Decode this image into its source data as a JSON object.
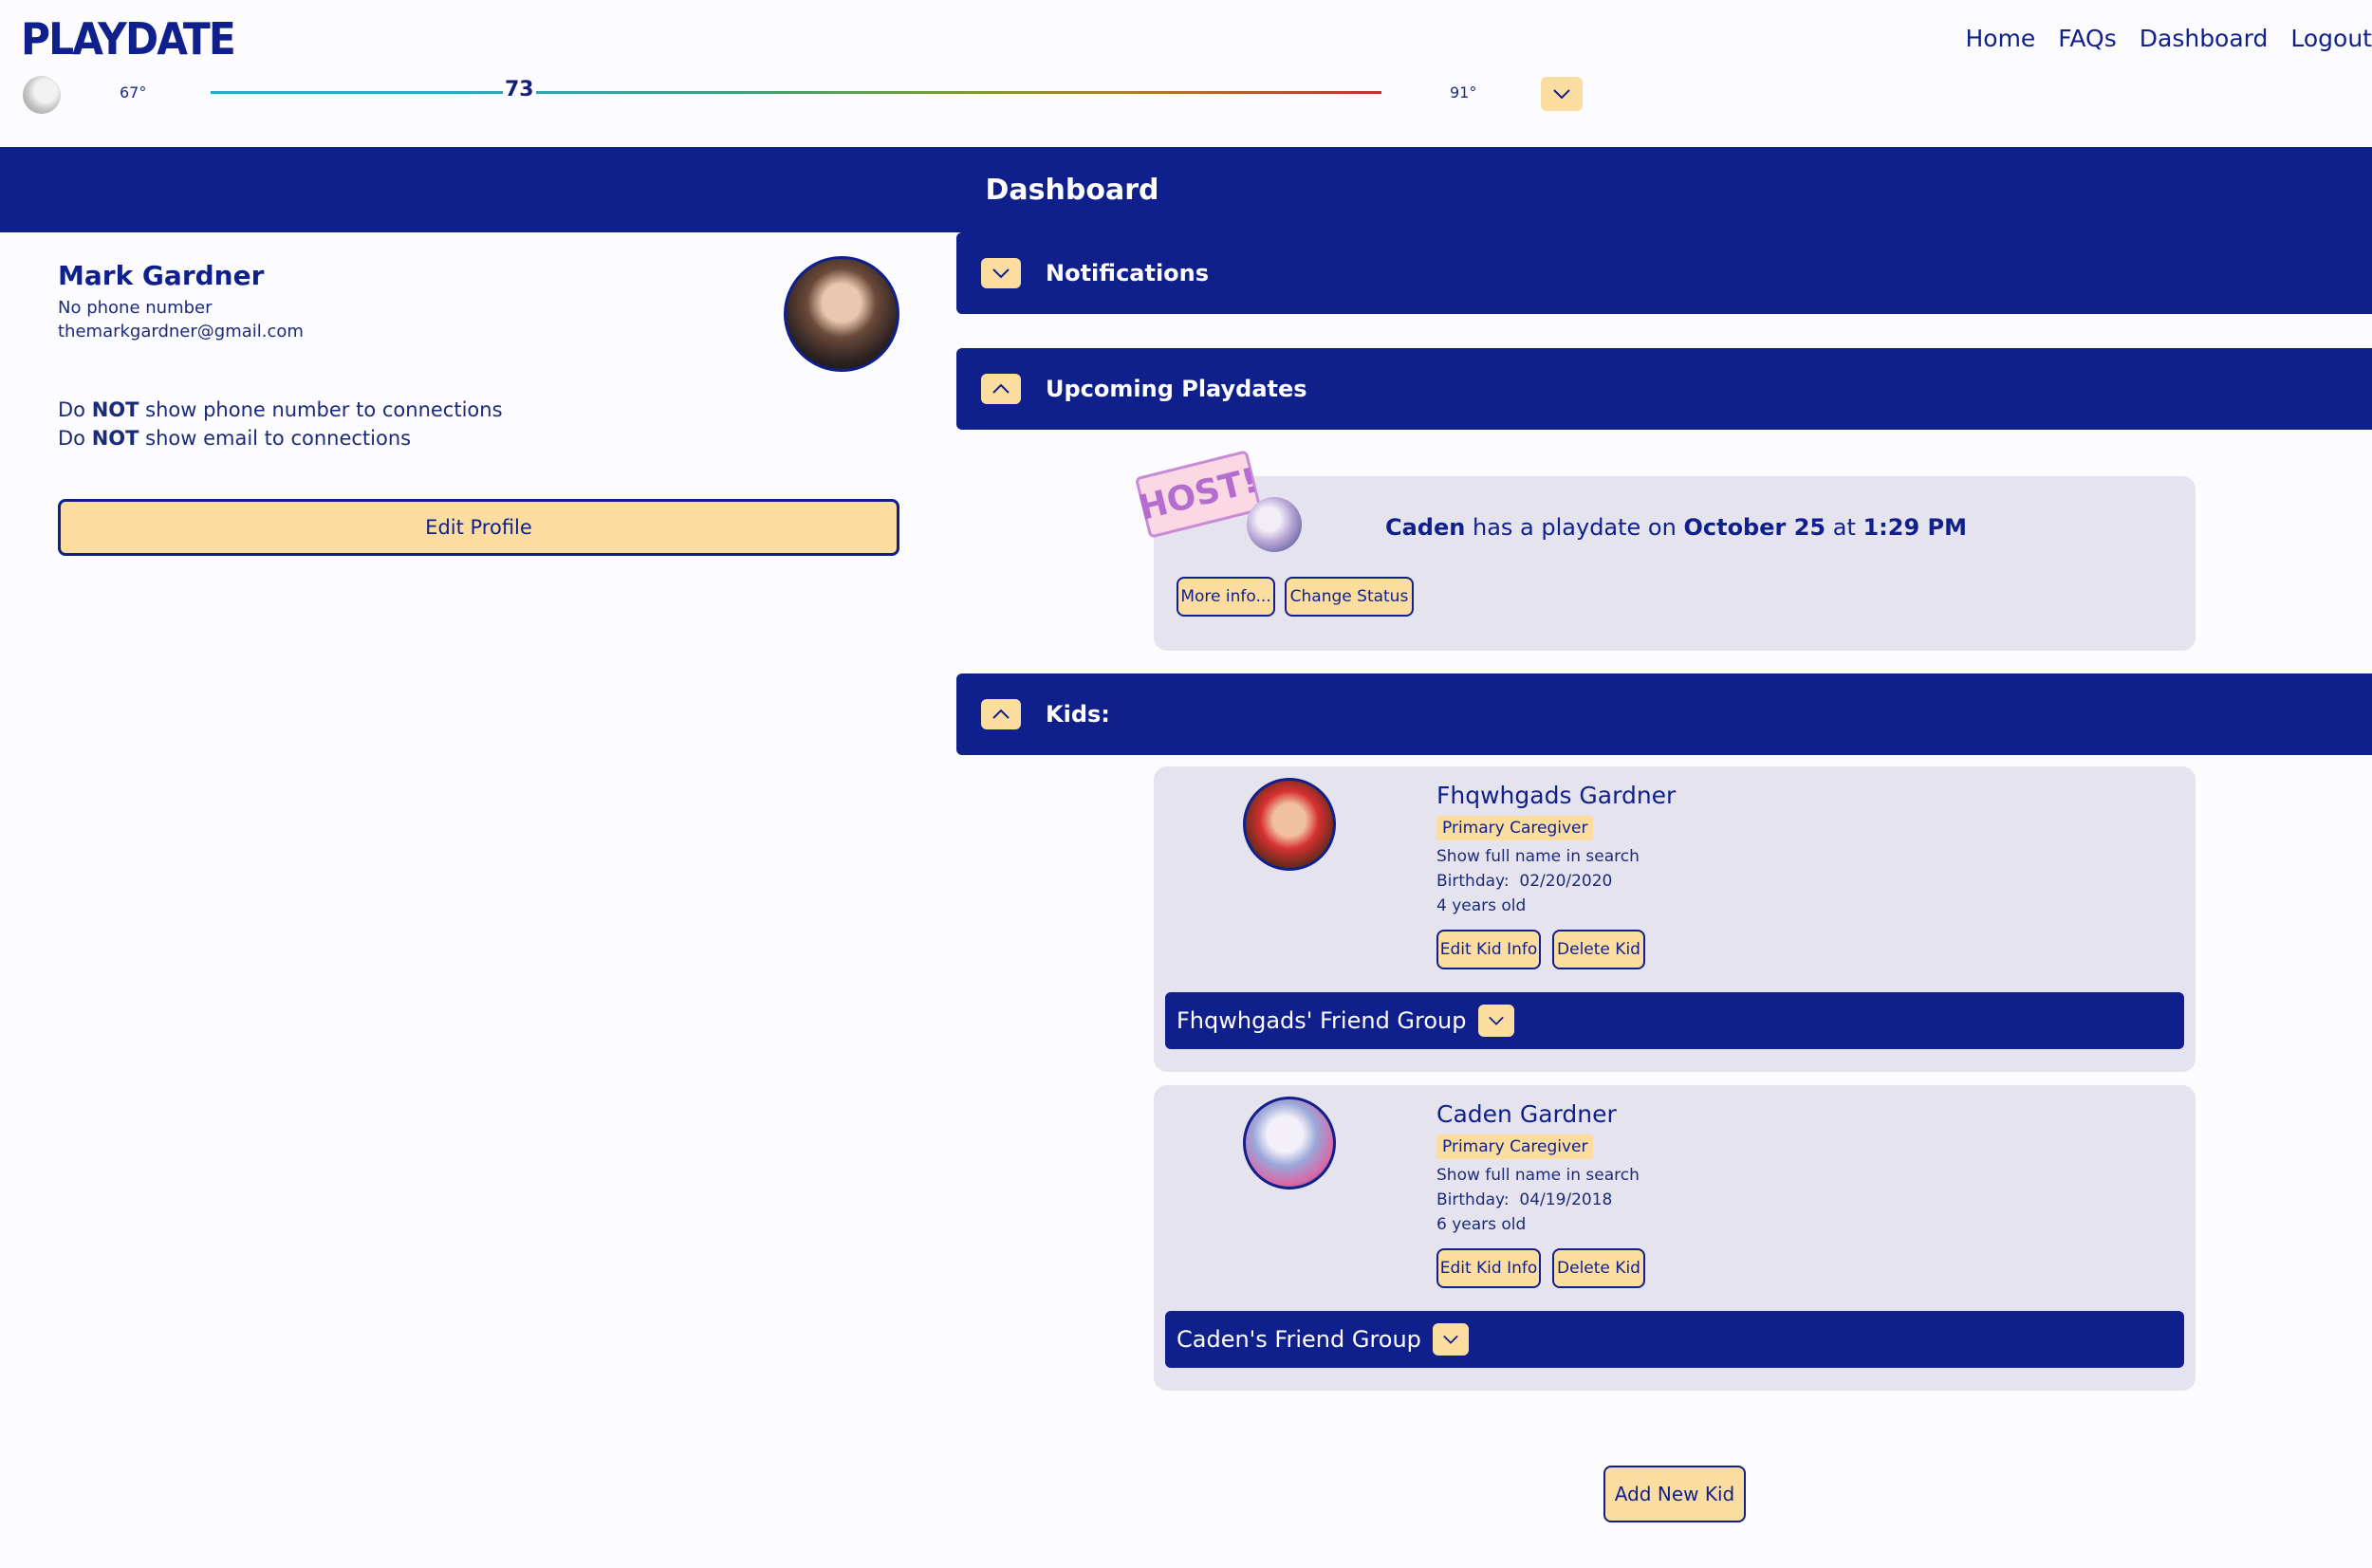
{
  "app": {
    "logo": "PLAYDATE"
  },
  "nav": [
    {
      "label": "Home"
    },
    {
      "label": "FAQs"
    },
    {
      "label": "Dashboard"
    },
    {
      "label": "Logout"
    }
  ],
  "weather": {
    "low": "67°",
    "current": "73",
    "high": "91°"
  },
  "banner": {
    "title": "Dashboard"
  },
  "profile": {
    "name": "Mark Gardner",
    "phone": "No phone number",
    "email": "themarkgardner@gmail.com",
    "privacy": [
      {
        "pre": "Do ",
        "strong": "NOT",
        "post": " show phone number to connections"
      },
      {
        "pre": "Do ",
        "strong": "NOT",
        "post": " show email to connections"
      }
    ],
    "edit_label": "Edit Profile"
  },
  "sections": {
    "notifications": "Notifications",
    "upcoming": "Upcoming Playdates",
    "kids": "Kids:"
  },
  "playdate": {
    "badge": "HOST!",
    "kid": "Caden",
    "text_mid": " has a playdate on ",
    "date": "October 25",
    "text_at": " at ",
    "time": "1:29 PM",
    "more_label": "More info...",
    "status_label": "Change Status"
  },
  "kids": [
    {
      "name": "Fhqwhgads Gardner",
      "role": "Primary Caregiver",
      "search": "Show full name in search",
      "birthday_label": "Birthday:",
      "birthday": "02/20/2020",
      "age": "4 years old",
      "edit_label": "Edit Kid Info",
      "delete_label": "Delete Kid",
      "group": "Fhqwhgads' Friend Group"
    },
    {
      "name": "Caden Gardner",
      "role": "Primary Caregiver",
      "search": "Show full name in search",
      "birthday_label": "Birthday:",
      "birthday": "04/19/2018",
      "age": "6 years old",
      "edit_label": "Edit Kid Info",
      "delete_label": "Delete Kid",
      "group": "Caden's Friend Group"
    }
  ],
  "add_kid_label": "Add New Kid",
  "colors": {
    "primary": "#0f1f8c",
    "accent": "#fcdda0",
    "card": "#e5e3ee"
  }
}
